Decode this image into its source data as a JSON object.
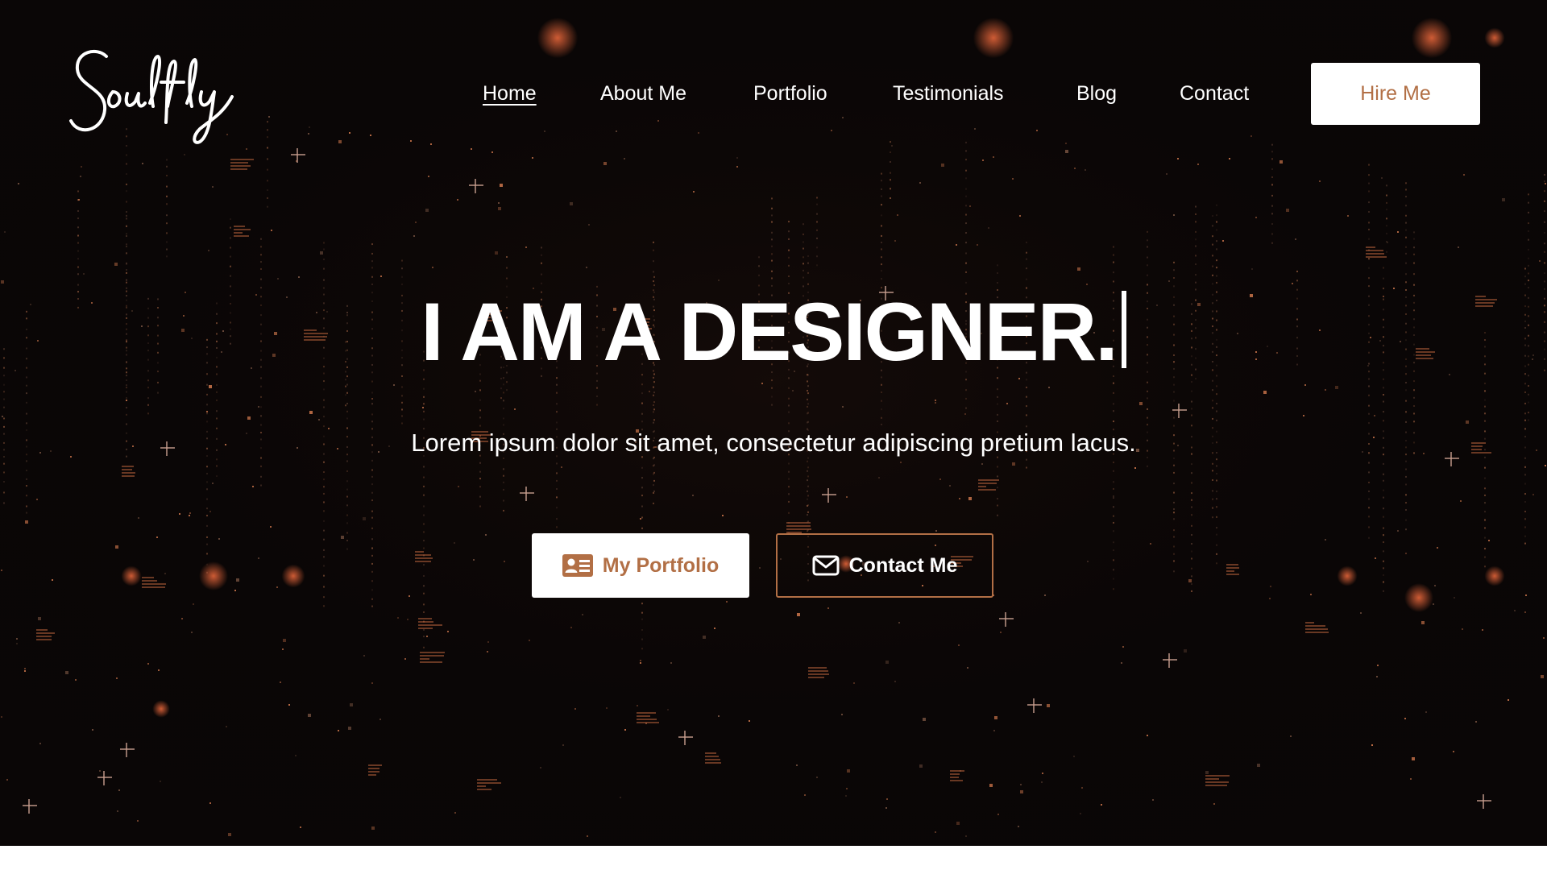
{
  "brand": {
    "logo_text": "Soulfly"
  },
  "nav": {
    "items": [
      {
        "label": "Home",
        "active": true
      },
      {
        "label": "About Me",
        "active": false
      },
      {
        "label": "Portfolio",
        "active": false
      },
      {
        "label": "Testimonials",
        "active": false
      },
      {
        "label": "Blog",
        "active": false
      },
      {
        "label": "Contact",
        "active": false
      }
    ],
    "cta_label": "Hire Me"
  },
  "hero": {
    "headline": "I AM A DESIGNER.",
    "subtitle": "Lorem ipsum dolor sit amet, consectetur adipiscing pretium lacus.",
    "buttons": {
      "portfolio_label": "My Portfolio",
      "portfolio_icon": "id-card-icon",
      "contact_label": "Contact Me",
      "contact_icon": "envelope-icon"
    }
  },
  "colors": {
    "background": "#0a0606",
    "accent": "#b26f45",
    "text": "#ffffff"
  }
}
